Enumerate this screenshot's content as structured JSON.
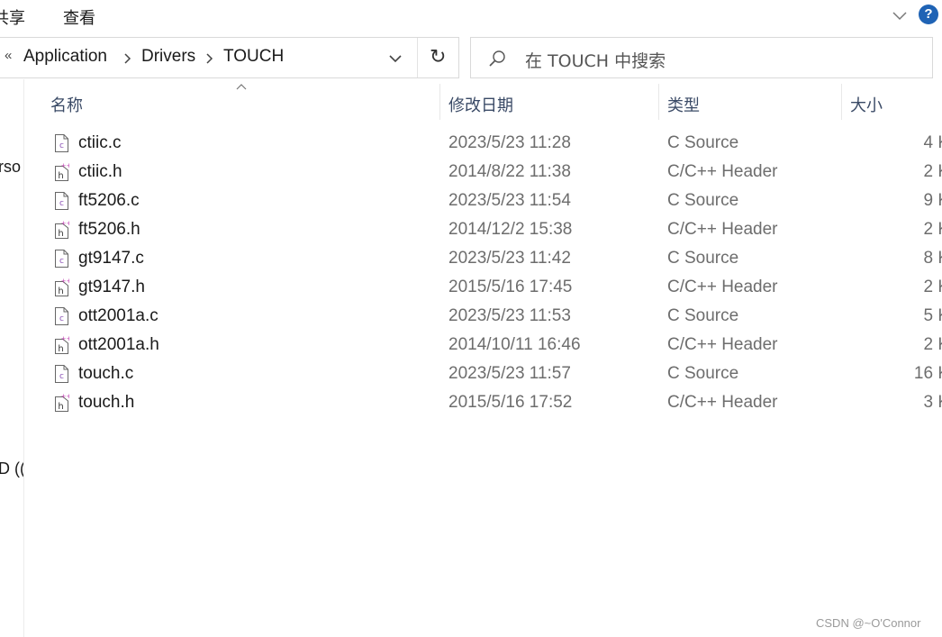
{
  "ribbon": {
    "tabs": [
      {
        "label": "共享"
      },
      {
        "label": "查看"
      }
    ],
    "help_label": "?"
  },
  "address": {
    "overflow_label": "«",
    "breadcrumbs": [
      {
        "label": "Application"
      },
      {
        "label": "Drivers"
      },
      {
        "label": "TOUCH"
      }
    ]
  },
  "search": {
    "placeholder": "在 TOUCH 中搜索"
  },
  "nav_pane": {
    "fragments": [
      "rso",
      "D (("
    ]
  },
  "columns": {
    "name": "名称",
    "date": "修改日期",
    "type": "类型",
    "size": "大小"
  },
  "files": [
    {
      "name": "ctiic.c",
      "date": "2023/5/23 11:28",
      "type": "C Source",
      "size": "4 K",
      "icon": "c-source-file-icon"
    },
    {
      "name": "ctiic.h",
      "date": "2014/8/22 11:38",
      "type": "C/C++ Header",
      "size": "2 K",
      "icon": "c-header-file-icon"
    },
    {
      "name": "ft5206.c",
      "date": "2023/5/23 11:54",
      "type": "C Source",
      "size": "9 K",
      "icon": "c-source-file-icon"
    },
    {
      "name": "ft5206.h",
      "date": "2014/12/2 15:38",
      "type": "C/C++ Header",
      "size": "2 K",
      "icon": "c-header-file-icon"
    },
    {
      "name": "gt9147.c",
      "date": "2023/5/23 11:42",
      "type": "C Source",
      "size": "8 K",
      "icon": "c-source-file-icon"
    },
    {
      "name": "gt9147.h",
      "date": "2015/5/16 17:45",
      "type": "C/C++ Header",
      "size": "2 K",
      "icon": "c-header-file-icon"
    },
    {
      "name": "ott2001a.c",
      "date": "2023/5/23 11:53",
      "type": "C Source",
      "size": "5 K",
      "icon": "c-source-file-icon"
    },
    {
      "name": "ott2001a.h",
      "date": "2014/10/11 16:46",
      "type": "C/C++ Header",
      "size": "2 K",
      "icon": "c-header-file-icon"
    },
    {
      "name": "touch.c",
      "date": "2023/5/23 11:57",
      "type": "C Source",
      "size": "16 K",
      "icon": "c-source-file-icon"
    },
    {
      "name": "touch.h",
      "date": "2015/5/16 17:52",
      "type": "C/C++ Header",
      "size": "3 K",
      "icon": "c-header-file-icon"
    }
  ],
  "watermark": "CSDN @~O'Connor",
  "colors": {
    "help_accent": "#1f63b5",
    "header_text": "#3a4a66",
    "c_icon_accent": "#8a4fb5",
    "h_icon_accent": "#c23fb3"
  }
}
